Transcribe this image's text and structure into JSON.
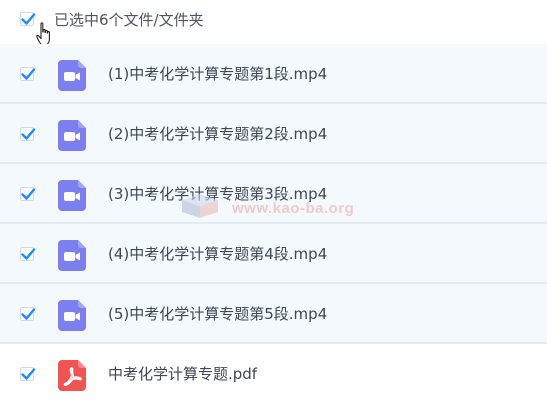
{
  "header": {
    "label": "已选中6个文件/文件夹",
    "checked": true
  },
  "files": [
    {
      "name": "(1)中考化学计算专题第1段.mp4",
      "type": "video",
      "checked": true
    },
    {
      "name": "(2)中考化学计算专题第2段.mp4",
      "type": "video",
      "checked": true
    },
    {
      "name": "(3)中考化学计算专题第3段.mp4",
      "type": "video",
      "checked": true
    },
    {
      "name": "(4)中考化学计算专题第4段.mp4",
      "type": "video",
      "checked": true
    },
    {
      "name": "(5)中考化学计算专题第5段.mp4",
      "type": "video",
      "checked": true
    },
    {
      "name": "中考化学计算专题.pdf",
      "type": "pdf",
      "checked": true
    }
  ],
  "watermark": {
    "text": "www.kao-ba.org"
  },
  "colors": {
    "checkmark": "#1a8cff",
    "video_icon": "#7b7ff0",
    "pdf_icon": "#f25454",
    "row_background": "#f4f9fe",
    "row_border": "#e2ecf7"
  },
  "icons": {
    "video": "video-camera-icon",
    "pdf": "pdf-icon",
    "check": "checkmark-icon",
    "cursor": "hand-pointer-icon"
  }
}
